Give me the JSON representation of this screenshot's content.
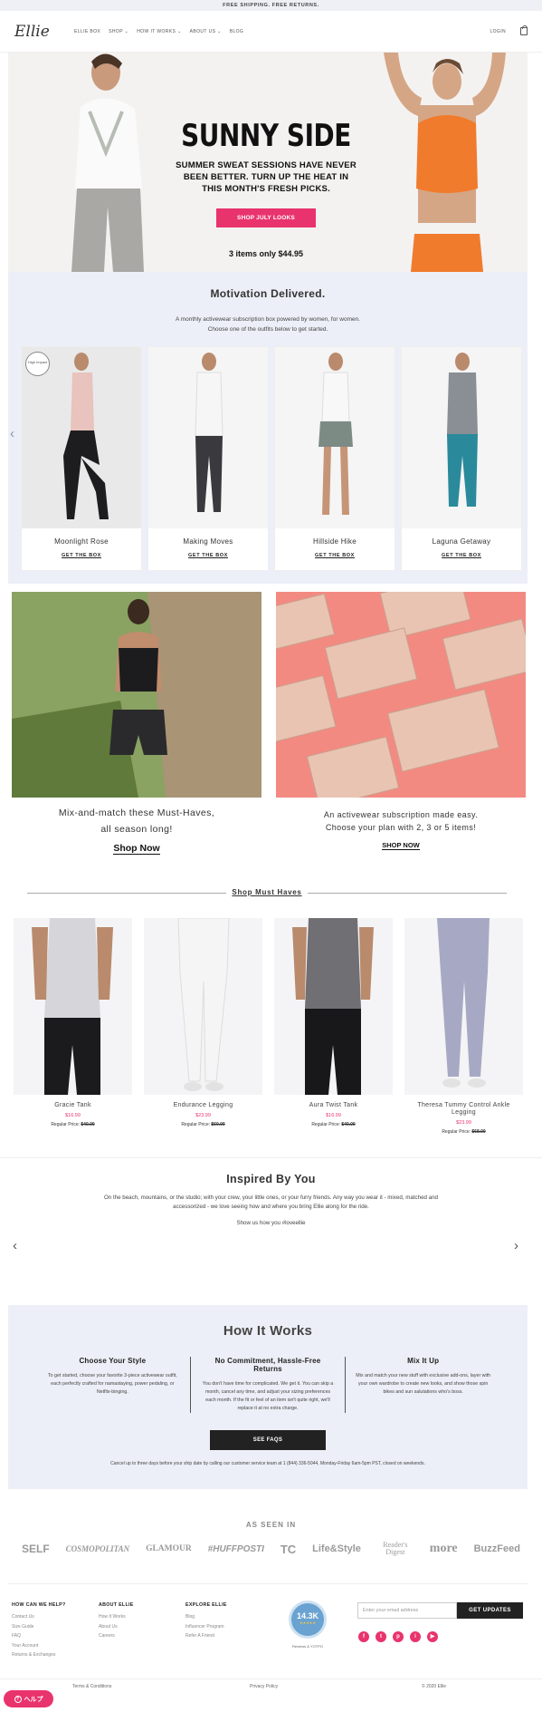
{
  "topbar": {
    "text": "FREE SHIPPING. FREE RETURNS."
  },
  "header": {
    "logo": "Ellie",
    "nav": [
      "ELLIE BOX",
      "SHOP ⌄",
      "HOW IT WORKS ⌄",
      "ABOUT US ⌄",
      "BLOG"
    ],
    "login": "LOGIN"
  },
  "hero": {
    "title": "SUNNY SIDE",
    "subtitle_1": "SUMMER SWEAT SESSIONS HAVE NEVER",
    "subtitle_2": "BEEN BETTER. TURN UP THE HEAT IN",
    "subtitle_3": "THIS MONTH'S FRESH PICKS.",
    "button": "SHOP JULY LOOKS",
    "price": "3 items only $44.95"
  },
  "motivation": {
    "title": "Motivation Delivered.",
    "desc_1": "A monthly activewear subscription box powered by women, for women.",
    "desc_2": "Choose one of the outfits below to get started.",
    "badge": "High Impact",
    "cards": [
      {
        "name": "Moonlight Rose",
        "link": "GET THE BOX"
      },
      {
        "name": "Making Moves",
        "link": "GET THE BOX"
      },
      {
        "name": "Hillside Hike",
        "link": "GET THE BOX"
      },
      {
        "name": "Laguna Getaway",
        "link": "GET THE BOX"
      }
    ]
  },
  "promos": [
    {
      "title_1": "Mix-and-match these Must-Haves,",
      "title_2": "all season long!",
      "link": "Shop Now"
    },
    {
      "title_1": "An activewear subscription made easy.",
      "title_2": "Choose your plan with 2, 3 or 5 items!",
      "link": "SHOP NOW"
    }
  ],
  "must_haves": {
    "title": "Shop Must Haves",
    "regular_label": "Regular Price:",
    "products": [
      {
        "name": "Gracie Tank",
        "price": "$16.99",
        "regular": "$40.00"
      },
      {
        "name": "Endurance Legging",
        "price": "$23.99",
        "regular": "$60.00"
      },
      {
        "name": "Aura Twist Tank",
        "price": "$16.99",
        "regular": "$40.00"
      },
      {
        "name": "Theresa Tummy Control Ankle Legging",
        "price": "$23.99",
        "regular": "$68.00"
      }
    ]
  },
  "inspired": {
    "title": "Inspired By You",
    "desc": "On the beach, mountains, or the studio; with your crew, your little ones, or your furry friends. Any way you wear it - mixed, matched and accessorized - we love seeing how and where you bring Ellie along for the ride.",
    "share": "Show us how you #loveellie"
  },
  "how": {
    "title": "How It Works",
    "cols": [
      {
        "title": "Choose Your Style",
        "text": "To get started, choose your favorite 3-piece activewear outfit, each perfectly crafted for namastaying, power pedaling, or Netflix-binging."
      },
      {
        "title": "No Commitment, Hassle-Free Returns",
        "text": "You don't have time for complicated. We get it. You can skip a month, cancel any time, and adjust your sizing preferences each month. If the fit or feel of an item isn't quite right, we'll replace it at no extra charge."
      },
      {
        "title": "Mix It Up",
        "text": "Mix and match your new stuff with exclusive add-ons, layer with your own wardrobe to create new looks, and show those spin bikes and sun salutations who's boss."
      }
    ],
    "button": "SEE FAQS",
    "note": "Cancel up to three days before your ship date by calling our customer service team at 1 (844) 336-5044, Monday-Friday 6am-5pm PST, closed on weekends."
  },
  "seen": {
    "title": "AS SEEN IN",
    "logos": [
      "SELF",
      "COSMOPOLITAN",
      "GLAMOUR",
      "#HUFFPOSTI",
      "TC",
      "Life&Style",
      "Reader's Digest",
      "more",
      "BuzzFeed"
    ]
  },
  "footer": {
    "cols": [
      {
        "title": "HOW CAN WE HELP?",
        "links": [
          "Contact Us",
          "Size Guide",
          "FAQ",
          "Your Account",
          "Returns & Exchanges"
        ]
      },
      {
        "title": "ABOUT ELLIE",
        "links": [
          "How It Works",
          "About Us",
          "Careers"
        ]
      },
      {
        "title": "EXPLORE ELLIE",
        "links": [
          "Blog",
          "Influencer Program",
          "Refer A Friend"
        ]
      }
    ],
    "rating": "14.3K",
    "rating_stars": "★★★★★",
    "rating_caption": "Reviews & YOTPO",
    "email_placeholder": "Enter your email address",
    "email_button": "GET UPDATES",
    "socials": [
      "f",
      "t",
      "p",
      "i",
      "▶"
    ]
  },
  "bottom": {
    "terms": "Terms & Conditions",
    "privacy": "Privacy Policy",
    "copyright": "© 2020 Ellie"
  },
  "help": {
    "label": "ヘルプ"
  },
  "colors": {
    "accent": "#e9336d",
    "panel": "#eceff7"
  }
}
